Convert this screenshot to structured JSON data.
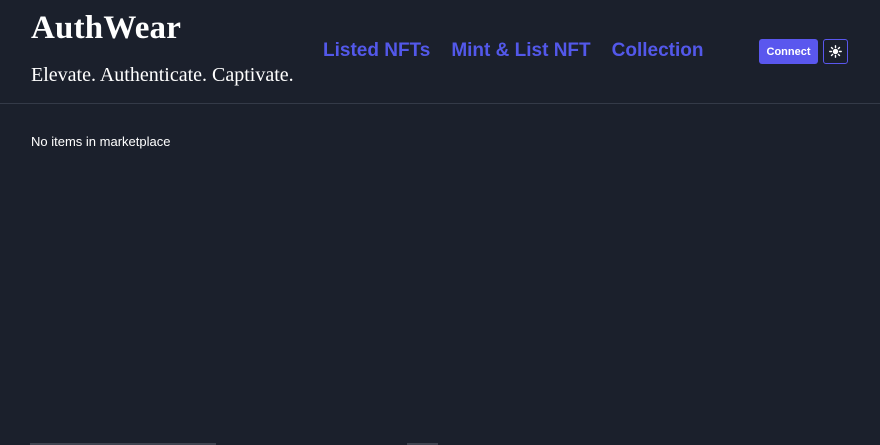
{
  "header": {
    "brand": "AuthWear",
    "tagline": "Elevate. Authenticate. Captivate.",
    "nav": [
      {
        "label": "Listed NFTs"
      },
      {
        "label": "Mint & List NFT"
      },
      {
        "label": "Collection"
      }
    ],
    "connect_label": "Connect",
    "theme_icon": "sun-icon"
  },
  "main": {
    "empty_message": "No items in marketplace"
  },
  "colors": {
    "background": "#1b202c",
    "accent": "#5358ea",
    "button": "#5a57ee",
    "text": "#ffffff"
  }
}
